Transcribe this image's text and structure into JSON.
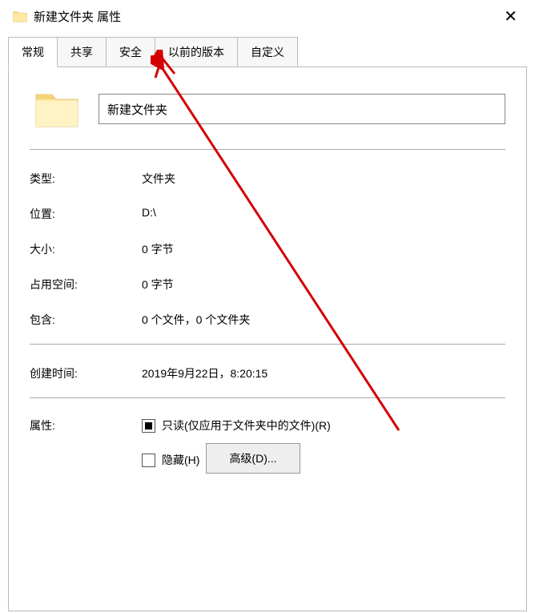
{
  "titlebar": {
    "title": "新建文件夹 属性"
  },
  "tabs": {
    "general": "常规",
    "share": "共享",
    "security": "安全",
    "previous": "以前的版本",
    "custom": "自定义"
  },
  "general": {
    "name_value": "新建文件夹",
    "type_label": "类型:",
    "type_value": "文件夹",
    "location_label": "位置:",
    "location_value": "D:\\",
    "size_label": "大小:",
    "size_value": "0 字节",
    "diskspace_label": "占用空间:",
    "diskspace_value": "0 字节",
    "contains_label": "包含:",
    "contains_value": "0 个文件，0 个文件夹",
    "created_label": "创建时间:",
    "created_value": "2019年9月22日，8:20:15",
    "attr_label": "属性:",
    "readonly_label": "只读(仅应用于文件夹中的文件)(R)",
    "hidden_label": "隐藏(H)",
    "advanced_btn": "高级(D)..."
  }
}
